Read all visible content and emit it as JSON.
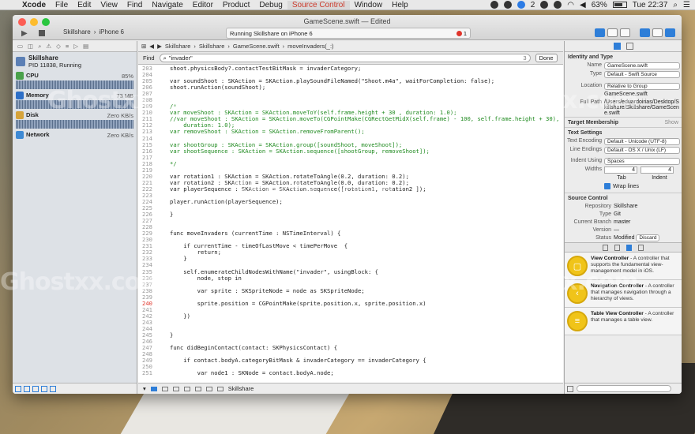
{
  "menubar": {
    "app": "Xcode",
    "items": [
      "File",
      "Edit",
      "View",
      "Find",
      "Navigate",
      "Editor",
      "Product",
      "Debug",
      "Source Control",
      "Window",
      "Help"
    ],
    "status": {
      "notif_count": "2",
      "battery": "63%",
      "clock": "Tue 22:37"
    }
  },
  "window": {
    "title": "GameScene.swift — Edited",
    "scheme_target": "Skillshare",
    "scheme_device": "iPhone 6",
    "activity": "Running Skillshare on iPhone 6",
    "error_count": "1"
  },
  "navigator": {
    "process_name": "Skillshare",
    "process_detail": "PID 11838, Running",
    "gauges": [
      {
        "name": "CPU",
        "value": "85%",
        "color": "#4aa14a"
      },
      {
        "name": "Memory",
        "value": "73 MB",
        "color": "#2d6fc7"
      },
      {
        "name": "Disk",
        "value": "Zero KB/s",
        "color": "#d6a33a"
      },
      {
        "name": "Network",
        "value": "Zero KB/s",
        "color": "#3d89d4"
      }
    ]
  },
  "jumpbar": [
    "Skillshare",
    "Skillshare",
    "GameScene.swift",
    "moveInvaders(_:)"
  ],
  "find": {
    "label": "Find",
    "query": "\"invader\"",
    "count": "3",
    "done_label": "Done"
  },
  "code": [
    {
      "n": "203",
      "t": "shoot.physicsBody?.contactTestBitMask = invaderCategory;"
    },
    {
      "n": "204",
      "t": ""
    },
    {
      "n": "205",
      "t": "var soundShoot : SKAction = SKAction.playSoundFileNamed(\"Shoot.m4a\", waitForCompletion: false);"
    },
    {
      "n": "206",
      "t": "shoot.runAction(soundShoot);"
    },
    {
      "n": "207",
      "t": ""
    },
    {
      "n": "208",
      "t": ""
    },
    {
      "n": "209",
      "t": "/*"
    },
    {
      "n": "210",
      "t": "var moveShoot : SKAction = SKAction.moveToY(self.frame.height + 30 , duration: 1.0);"
    },
    {
      "n": "211",
      "t": "//var moveShoot : SKAction = SKAction.moveTo(CGPointMake(CGRectGetMidX(self.frame) - 100, self.frame.height + 30),"
    },
    {
      "n": "212",
      "t": "    duration: 1.0);"
    },
    {
      "n": "213",
      "t": "var removeShoot : SKAction = SKAction.removeFromParent();"
    },
    {
      "n": "214",
      "t": ""
    },
    {
      "n": "215",
      "t": "var shootGroup : SKAction = SKAction.group([soundShoot, moveShoot]);"
    },
    {
      "n": "216",
      "t": "var shootSequence : SKAction = SKAction.sequence([shootGroup, removeShoot]);"
    },
    {
      "n": "217",
      "t": ""
    },
    {
      "n": "218",
      "t": "*/"
    },
    {
      "n": "219",
      "t": ""
    },
    {
      "n": "220",
      "t": "var rotation1 : SKAction = SKAction.rotateToAngle(0.2, duration: 0.2);"
    },
    {
      "n": "221",
      "t": "var rotation2 : SKAction = SKAction.rotateToAngle(0.0, duration: 0.2);"
    },
    {
      "n": "222",
      "t": "var playerSequence : SKAction = SKAction.sequence([rotation1, rotation2 ]);"
    },
    {
      "n": "223",
      "t": ""
    },
    {
      "n": "224",
      "t": "player.runAction(playerSequence);"
    },
    {
      "n": "225",
      "t": ""
    },
    {
      "n": "226",
      "t": "}"
    },
    {
      "n": "227",
      "t": ""
    },
    {
      "n": "228",
      "t": ""
    },
    {
      "n": "229",
      "t": "func moveInvaders (currentTime : NSTimeInterval) {"
    },
    {
      "n": "230",
      "t": ""
    },
    {
      "n": "231",
      "t": "    if currentTime - timeOfLastMove < timePerMove  {"
    },
    {
      "n": "232",
      "t": "        return;"
    },
    {
      "n": "233",
      "t": "    }"
    },
    {
      "n": "234",
      "t": ""
    },
    {
      "n": "235",
      "t": "    self.enumerateChildNodesWithName(\"invader\", usingBlock: {"
    },
    {
      "n": "236",
      "t": "        node, stop in"
    },
    {
      "n": "237",
      "t": ""
    },
    {
      "n": "238",
      "t": "        var sprite : SKSpriteNode = node as SKSpriteNode;"
    },
    {
      "n": "239",
      "t": ""
    },
    {
      "n": "240",
      "t": "        sprite.position = CGPointMake(sprite.position.x, sprite.position.x)"
    },
    {
      "n": "241",
      "t": ""
    },
    {
      "n": "242",
      "t": "    })"
    },
    {
      "n": "243",
      "t": ""
    },
    {
      "n": "244",
      "t": ""
    },
    {
      "n": "245",
      "t": "}"
    },
    {
      "n": "246",
      "t": ""
    },
    {
      "n": "247",
      "t": "func didBeginContact(contact: SKPhysicsContact) {"
    },
    {
      "n": "248",
      "t": ""
    },
    {
      "n": "249",
      "t": "    if contact.bodyA.categoryBitMask & invaderCategory == invaderCategory {"
    },
    {
      "n": "250",
      "t": ""
    },
    {
      "n": "251",
      "t": "        var node1 : SKNode = contact.bodyA.node;"
    }
  ],
  "debug_bar": {
    "target": "Skillshare"
  },
  "inspector": {
    "identity_title": "Identity and Type",
    "name_label": "Name",
    "name_value": "GameScene.swift",
    "type_label": "Type",
    "type_value": "Default - Swift Source",
    "location_label": "Location",
    "location_value": "Relative to Group",
    "location_file": "GameScene.swift",
    "fullpath_label": "Full Path",
    "fullpath_value": "/Users/eduardoirias/Desktop/Skillshare/Skillshare/GameScene.swift",
    "target_title": "Target Membership",
    "target_show": "Show",
    "text_title": "Text Settings",
    "encoding_label": "Text Encoding",
    "encoding_value": "Default - Unicode (UTF-8)",
    "endings_label": "Line Endings",
    "endings_value": "Default - OS X / Unix (LF)",
    "indent_label": "Indent Using",
    "indent_value": "Spaces",
    "widths_label": "Widths",
    "tab_value": "4",
    "indent_width_value": "4",
    "tab_caption": "Tab",
    "indent_caption": "Indent",
    "wrap_label": "Wrap lines",
    "sc_title": "Source Control",
    "repo_label": "Repository",
    "repo_value": "Skillshare",
    "scm_type_label": "Type",
    "scm_type_value": "Git",
    "branch_label": "Current Branch",
    "branch_value": "master",
    "version_label": "Version",
    "version_value": "—",
    "status_label": "Status",
    "status_value": "Modified",
    "discard_label": "Discard"
  },
  "library": [
    {
      "title": "View Controller",
      "desc": "- A controller that supports the fundamental view-management model in iOS."
    },
    {
      "title": "Navigation Controller",
      "desc": "- A controller that manages navigation through a hierarchy of views."
    },
    {
      "title": "Table View Controller",
      "desc": "- A controller that manages a table view."
    }
  ],
  "watermark": "Ghostxx.com"
}
